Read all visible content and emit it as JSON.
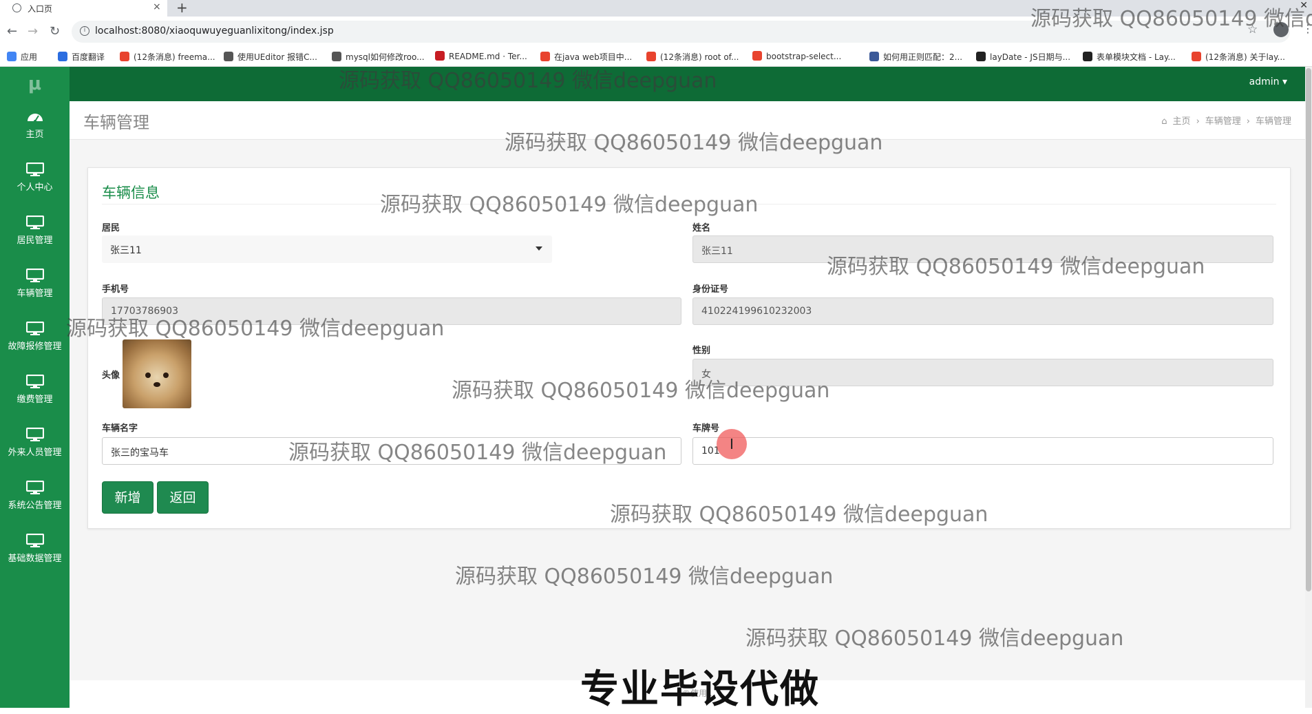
{
  "browser": {
    "tab_title": "入口页",
    "url": "localhost:8080/xiaoquwuyeguanlixitong/index.jsp",
    "bookmarks": [
      {
        "label": "应用",
        "color": "#4285f4"
      },
      {
        "label": "百度翻译",
        "color": "#2b6de0"
      },
      {
        "label": "(12条消息) freema...",
        "color": "#e8432e"
      },
      {
        "label": "使用UEditor 报错C...",
        "color": "#555555"
      },
      {
        "label": "mysql如何修改roo...",
        "color": "#555555"
      },
      {
        "label": "README.md · Ter...",
        "color": "#c71d23"
      },
      {
        "label": "在java web项目中...",
        "color": "#e8432e"
      },
      {
        "label": "(12条消息) root of...",
        "color": "#e8432e"
      },
      {
        "label": "bootstrap-select...",
        "color": "#e8432e"
      },
      {
        "label": "如何用正则匹配：2...",
        "color": "#3b5998"
      },
      {
        "label": "layDate - JS日期与...",
        "color": "#222222"
      },
      {
        "label": "表单模块文档 - Lay...",
        "color": "#222222"
      },
      {
        "label": "(12条消息) 关于lay...",
        "color": "#e8432e"
      }
    ]
  },
  "app": {
    "logo": "μ",
    "user": "admin ▾",
    "sidebar": [
      {
        "label": "主页",
        "icon": "dashboard-icon"
      },
      {
        "label": "个人中心",
        "icon": "monitor-icon"
      },
      {
        "label": "居民管理",
        "icon": "monitor-icon"
      },
      {
        "label": "车辆管理",
        "icon": "monitor-icon"
      },
      {
        "label": "故障报修管理",
        "icon": "monitor-icon"
      },
      {
        "label": "缴费管理",
        "icon": "monitor-icon"
      },
      {
        "label": "外来人员管理",
        "icon": "monitor-icon"
      },
      {
        "label": "系统公告管理",
        "icon": "monitor-icon"
      },
      {
        "label": "基础数据管理",
        "icon": "monitor-icon"
      }
    ],
    "page_title": "车辆管理",
    "breadcrumb": [
      "主页",
      "车辆管理",
      "车辆管理"
    ]
  },
  "form": {
    "title": "车辆信息",
    "resident_label": "居民",
    "resident_value": "张三11",
    "name_label": "姓名",
    "name_value": "张三11",
    "phone_label": "手机号",
    "phone_value": "17703786903",
    "idcard_label": "身份证号",
    "idcard_value": "410224199610232003",
    "avatar_label": "头像",
    "gender_label": "性别",
    "gender_value": "女",
    "car_name_label": "车辆名字",
    "car_name_value": "张三的宝马车",
    "plate_label": "车牌号",
    "plate_value": "101",
    "add_button": "新增",
    "back_button": "返回"
  },
  "overlay": {
    "watermark": "源码获取 QQ86050149 微信deepguan",
    "watermark_partial": "源码获取 QQ86050149 微信d",
    "banner": "专业毕设代做",
    "footnote": "©使用..."
  }
}
